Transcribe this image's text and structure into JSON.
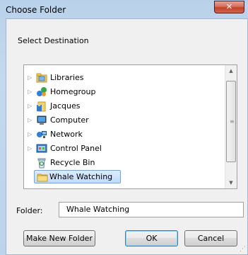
{
  "window": {
    "title": "Choose Folder",
    "close_glyph": "✕"
  },
  "dialog": {
    "subtitle": "Select Destination"
  },
  "tree": {
    "items": [
      {
        "label": "Libraries",
        "icon": "libraries-icon",
        "expandable": true
      },
      {
        "label": "Homegroup",
        "icon": "homegroup-icon",
        "expandable": true
      },
      {
        "label": "Jacques",
        "icon": "user-folder-icon",
        "expandable": true
      },
      {
        "label": "Computer",
        "icon": "computer-icon",
        "expandable": true
      },
      {
        "label": "Network",
        "icon": "network-icon",
        "expandable": true
      },
      {
        "label": "Control Panel",
        "icon": "control-panel-icon",
        "expandable": true
      },
      {
        "label": "Recycle Bin",
        "icon": "recycle-bin-icon",
        "expandable": false
      },
      {
        "label": "Whale Watching",
        "icon": "folder-icon",
        "expandable": false,
        "selected": true
      }
    ],
    "expander_glyph": "▷",
    "scroll_up_glyph": "▲",
    "scroll_down_glyph": "▼",
    "grip_glyph": "≡"
  },
  "folder": {
    "label": "Folder:",
    "value": "Whale Watching"
  },
  "buttons": {
    "make_new_folder": "Make New Folder",
    "ok": "OK",
    "cancel": "Cancel"
  },
  "colors": {
    "selection": "#cce4fc",
    "accent": "#3c7fb1",
    "close": "#c34228"
  }
}
